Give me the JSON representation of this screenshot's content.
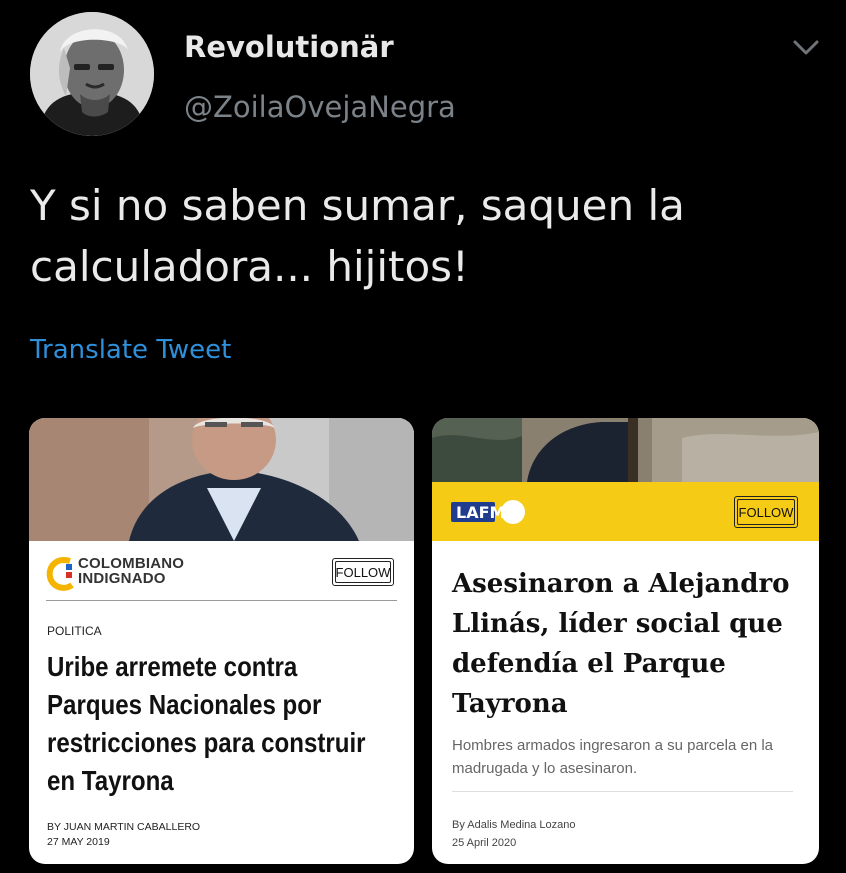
{
  "tweet": {
    "author_name": "Revolutionär",
    "handle": "@ZoilaOvejaNegra",
    "text": "Y si no saben sumar, saquen la calculadora... hijitos!",
    "translate_link": "Translate Tweet",
    "menu_icon": "chevron-down-icon"
  },
  "cards": [
    {
      "publication_logo_lines": [
        "COLOMBIANO",
        "INDIGNADO"
      ],
      "follow_label": "FOLLOW",
      "section": "POLITICA",
      "headline": "Uribe arremete contra Parques Nacionales por restricciones para construir en Tayrona",
      "byline": "BY JUAN MARTIN CABALLERO",
      "date": "27 MAY 2019"
    },
    {
      "publication_logo": "LAFM.",
      "follow_label": "FOLLOW",
      "headline": "Asesinaron a Alejandro Llinás, líder social que defendía el Parque Tayrona",
      "subhead": "Hombres armados ingresaron a su parcela en la madrugada y lo asesinaron.",
      "byline": "By Adalis Medina Lozano",
      "date": "25 April 2020"
    }
  ],
  "colors": {
    "background": "#000000",
    "link": "#2f8fd9",
    "lafm_band": "#f6cb16",
    "lafm_blue": "#1f3c8f"
  }
}
